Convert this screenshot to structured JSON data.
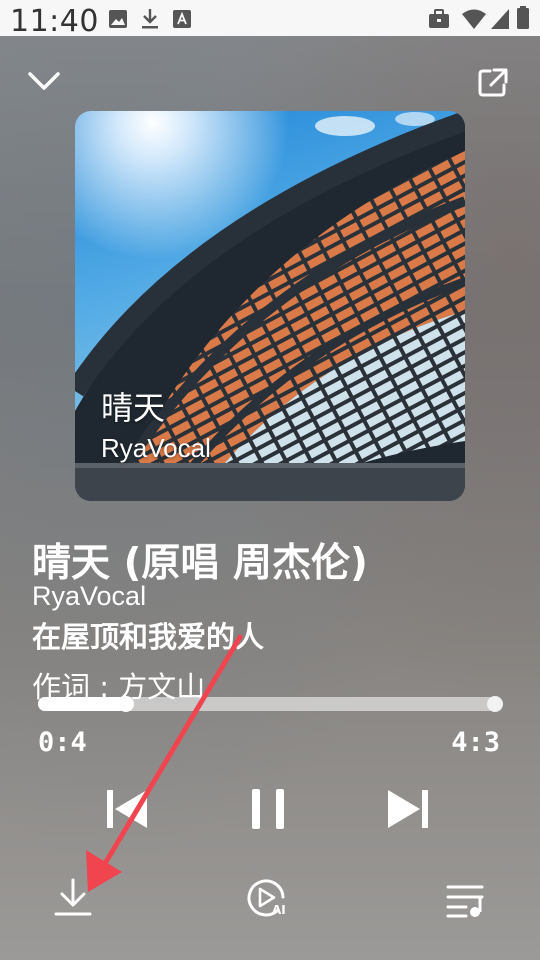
{
  "status_bar": {
    "time": "11:40",
    "icons": [
      "image-icon",
      "download-icon",
      "font-icon",
      "briefcase-icon",
      "wifi-icon",
      "signal-icon",
      "battery-icon"
    ]
  },
  "header": {
    "collapse_icon": "chevron-down-icon",
    "share_icon": "share-external-icon"
  },
  "album": {
    "title": "晴天",
    "artist": "RyaVocal"
  },
  "song": {
    "title": "晴天 (原唱 周杰伦)",
    "artist": "RyaVocal",
    "lyric_current": "在屋顶和我爱的人",
    "lyric_next": "作词 : 方文山"
  },
  "progress": {
    "current_time": "0:4",
    "total_time": "4:3",
    "fraction": 0.19
  },
  "controls": {
    "previous_icon": "skip-previous-icon",
    "play_pause_icon": "pause-icon",
    "next_icon": "skip-next-icon"
  },
  "bottom_bar": {
    "download_icon": "download-icon",
    "ai_play_icon": "ai-play-icon",
    "ai_badge": "AI",
    "queue_icon": "playlist-icon"
  },
  "colors": {
    "annotation_arrow": "#f0454f",
    "text": "#ffffff"
  }
}
